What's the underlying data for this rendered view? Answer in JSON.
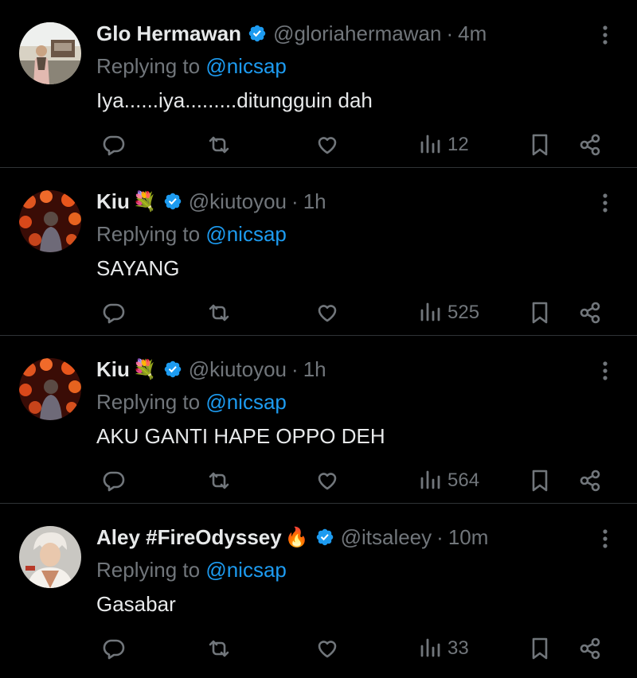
{
  "colors": {
    "background": "#000000",
    "text": "#e7e9ea",
    "muted": "#71767b",
    "accent": "#1d9bf0",
    "divider": "#2f3336"
  },
  "reply_prefix": "Replying to",
  "tweets": [
    {
      "name": "Glo Hermawan",
      "emoji": "",
      "handle": "@gloriahermawan",
      "time": "4m",
      "mention": "@nicsap",
      "text": "Iya......iya.........ditungguin dah",
      "views": "12",
      "avatar": "photo-outdoor"
    },
    {
      "name": "Kiu",
      "emoji": "💐",
      "handle": "@kiutoyou",
      "time": "1h",
      "mention": "@nicsap",
      "text": "SAYANG",
      "views": "525",
      "avatar": "photo-lanterns"
    },
    {
      "name": "Kiu",
      "emoji": "💐",
      "handle": "@kiutoyou",
      "time": "1h",
      "mention": "@nicsap",
      "text": "AKU GANTI HAPE OPPO DEH",
      "views": "564",
      "avatar": "photo-lanterns"
    },
    {
      "name": "Aley #FireOdyssey",
      "emoji": "🔥",
      "handle": "@itsaleey",
      "time": "10m",
      "mention": "@nicsap",
      "text": "Gasabar",
      "views": "33",
      "avatar": "anime-character"
    }
  ]
}
